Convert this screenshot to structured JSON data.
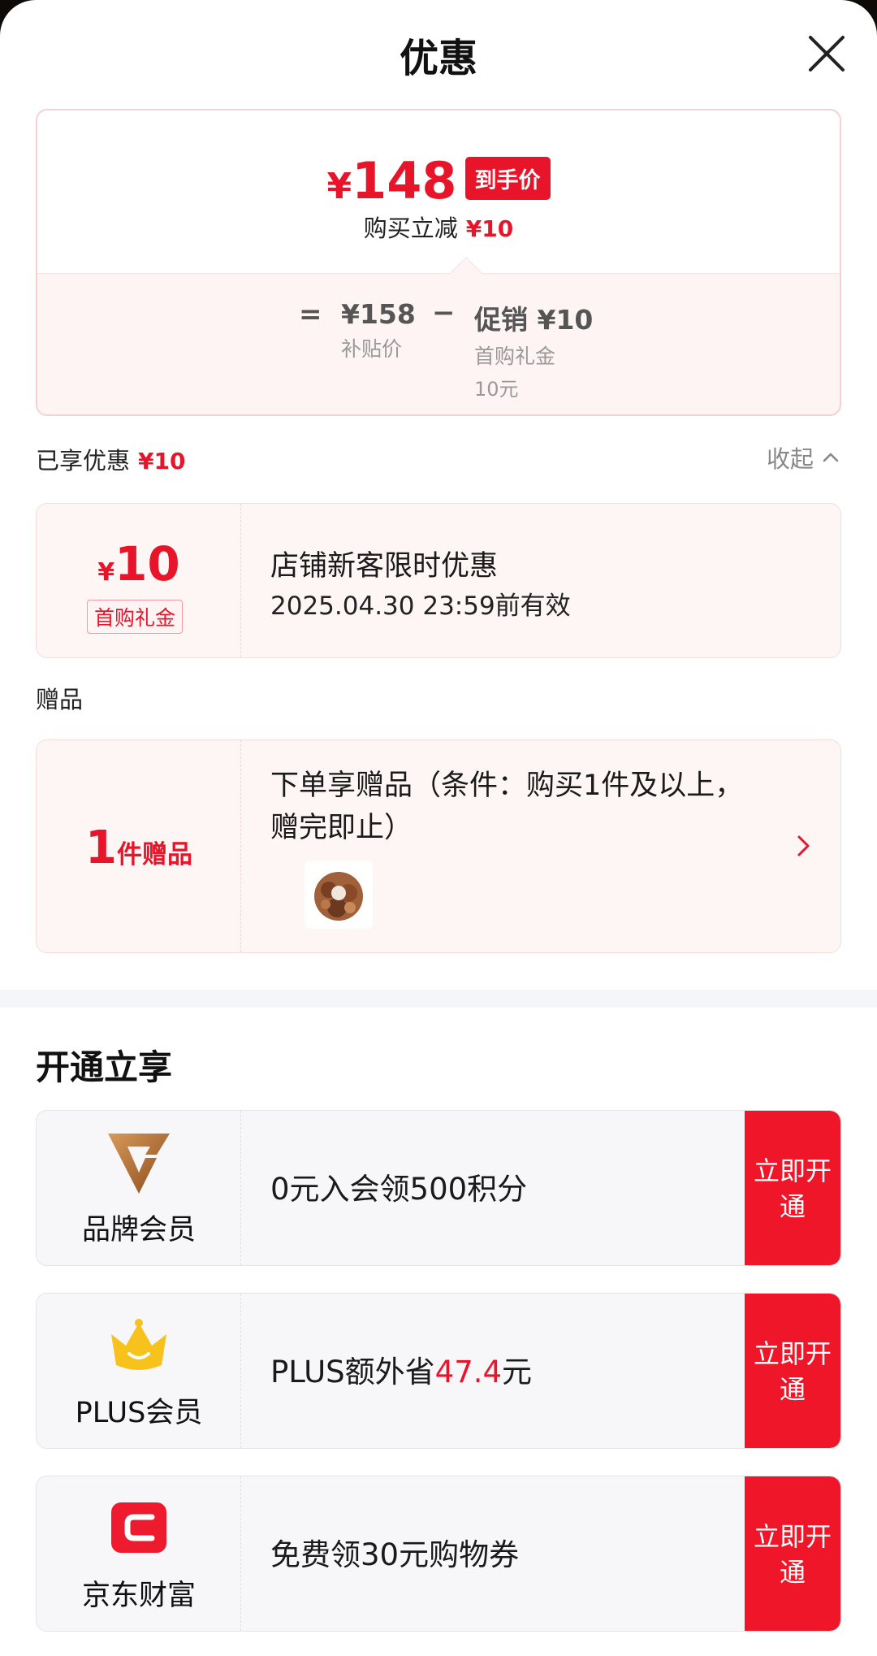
{
  "header": {
    "title": "优惠"
  },
  "price_summary": {
    "final_price_symbol": "¥",
    "final_price_value": "148",
    "final_price_tag": "到手价",
    "purchase_reduce_label": "购买立减",
    "purchase_reduce_value": "¥10",
    "equals_symbol": "=",
    "minus_symbol": "−",
    "subsidy_price": "¥158",
    "subsidy_label": "补贴价",
    "promo_value": "促销 ¥10",
    "promo_label": "首购礼金",
    "promo_sub": "10元"
  },
  "enjoyed": {
    "label": "已享优惠",
    "value": "¥10",
    "collapse_label": "收起"
  },
  "coupon": {
    "yen": "¥",
    "amount": "10",
    "badge": "首购礼金",
    "title": "店铺新客限时优惠",
    "validity": "2025.04.30 23:59前有效"
  },
  "gift": {
    "section_label": "赠品",
    "count": "1",
    "count_unit": "件赠品",
    "description": "下单享赠品（条件：购买1件及以上，赠完即止）"
  },
  "open_section": {
    "title": "开通立享",
    "items": [
      {
        "name": "品牌会员",
        "text_before": "0元入会领500积分",
        "highlight": "",
        "text_after": "",
        "button": "立即开通",
        "icon": "brand-v-icon"
      },
      {
        "name": "PLUS会员",
        "text_before": "PLUS额外省",
        "highlight": "47.4",
        "text_after": "元",
        "button": "立即开通",
        "icon": "crown-icon"
      },
      {
        "name": "京东财富",
        "text_before": "免费领30元购物券",
        "highlight": "",
        "text_after": "",
        "button": "立即开通",
        "icon": "jd-wealth-icon"
      }
    ]
  },
  "colors": {
    "accent": "#e8152a",
    "button": "#f0162a",
    "card_pink": "#fef5f5",
    "card_gray": "#f7f7f9"
  }
}
